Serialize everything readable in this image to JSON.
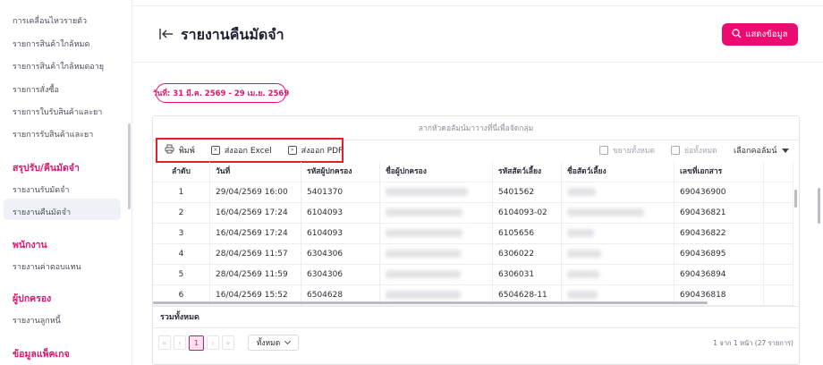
{
  "sidebar": {
    "items_top": [
      "การเคลื่อนไหวรายตัว",
      "รายการสินค้าใกล้หมด",
      "รายการสินค้าใกล้หมดอายุ",
      "รายการสั่งซื้อ",
      "รายการใบรับสินค้าและยา",
      "รายการรับสินค้าและยา"
    ],
    "section_return": "สรุปรับ/คืนมัดจำ",
    "items_return": [
      "รายงานรับมัดจำ",
      "รายงานคืนมัดจำ"
    ],
    "section_staff": "พนักงาน",
    "items_staff": [
      "รายงานค่าตอบแทน"
    ],
    "section_owner": "ผู้ปกครอง",
    "items_owner": [
      "รายงานลูกหนี้"
    ],
    "section_package": "ข้อมูลแพ็คเกจ"
  },
  "header": {
    "back_icon": "collapse-left-icon",
    "title": "รายงานคืนมัดจำ",
    "show_button": "แสดงข้อมูล",
    "accent_color": "#ee0b71"
  },
  "date_filter": "วันที่: 31 มี.ค. 2569 - 29 เม.ย. 2569",
  "grid": {
    "group_hint": "ลากหัวคอลัมน์มาวางที่นี่เพื่อจัดกลุ่ม",
    "toolbar": {
      "print": "พิมพ์",
      "export_excel": "ส่งออก Excel",
      "export_pdf": "ส่งออก PDF",
      "expand_all": "ขยายทั้งหมด",
      "collapse_all": "ย่อทั้งหมด",
      "choose_columns": "เลือกคอลัมน์"
    },
    "columns": [
      "ลำดับ",
      "วันที่",
      "รหัสผู้ปกครอง",
      "ชื่อผู้ปกครอง",
      "รหัสสัตว์เลี้ยง",
      "ชื่อสัตว์เลี้ยง",
      "เลขที่เอกสาร"
    ],
    "rows": [
      {
        "no": "1",
        "date": "29/04/2569 16:00",
        "owner_code": "5401370",
        "pet_code": "5401562",
        "doc_no": "690436900"
      },
      {
        "no": "2",
        "date": "16/04/2569 17:24",
        "owner_code": "6104093",
        "pet_code": "6104093-02",
        "doc_no": "690436821"
      },
      {
        "no": "3",
        "date": "16/04/2569 17:24",
        "owner_code": "6104093",
        "pet_code": "6105656",
        "doc_no": "690436822"
      },
      {
        "no": "4",
        "date": "28/04/2569 11:57",
        "owner_code": "6304306",
        "pet_code": "6306022",
        "doc_no": "690436895"
      },
      {
        "no": "5",
        "date": "28/04/2569 11:59",
        "owner_code": "6304306",
        "pet_code": "6306031",
        "doc_no": "690436894"
      },
      {
        "no": "6",
        "date": "16/04/2569 15:52",
        "owner_code": "6504628",
        "pet_code": "6504628-11",
        "doc_no": "690436818"
      }
    ],
    "total_label": "รวมทั้งหมด",
    "pager": {
      "first": "«",
      "prev": "‹",
      "current": "1",
      "next": "›",
      "last": "»",
      "page_size": "ทั้งหมด",
      "info": "1 จาก 1 หน้า (27 รายการ)"
    }
  }
}
